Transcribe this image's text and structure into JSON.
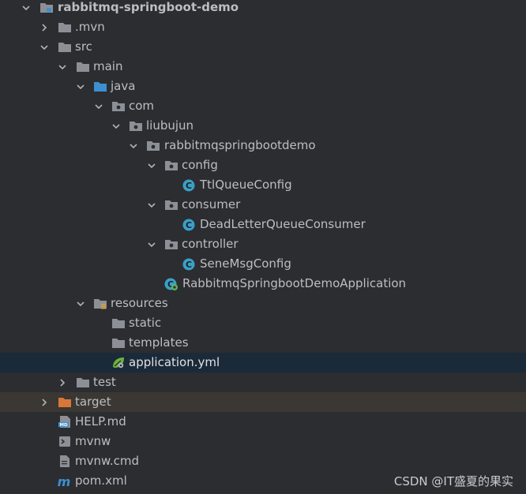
{
  "project_tree": {
    "root": "rabbitmq-springboot-demo",
    "mvn": ".mvn",
    "src": "src",
    "main": "main",
    "java": "java",
    "com": "com",
    "liubujun": "liubujun",
    "pkg": "rabbitmqspringbootdemo",
    "config": "config",
    "ttl_queue_config": "TtlQueueConfig",
    "consumer": "consumer",
    "dead_letter_consumer": "DeadLetterQueueConsumer",
    "controller": "controller",
    "sene_msg_config": "SeneMsgConfig",
    "application_class": "RabbitmqSpringbootDemoApplication",
    "resources": "resources",
    "static": "static",
    "templates": "templates",
    "application_yml": "application.yml",
    "test": "test",
    "target": "target",
    "help_md": "HELP.md",
    "mvnw": "mvnw",
    "mvnw_cmd": "mvnw.cmd",
    "pom_xml": "pom.xml"
  },
  "watermark": "CSDN @IT盛夏的果实",
  "colors": {
    "background": "#2b2d30",
    "selection": "#1b2a38",
    "excluded_row": "#3b3732",
    "folder": "#8c9096",
    "source_folder": "#3d8fd1",
    "excluded_folder": "#d9773b",
    "class_icon": "#3aa0c8"
  }
}
